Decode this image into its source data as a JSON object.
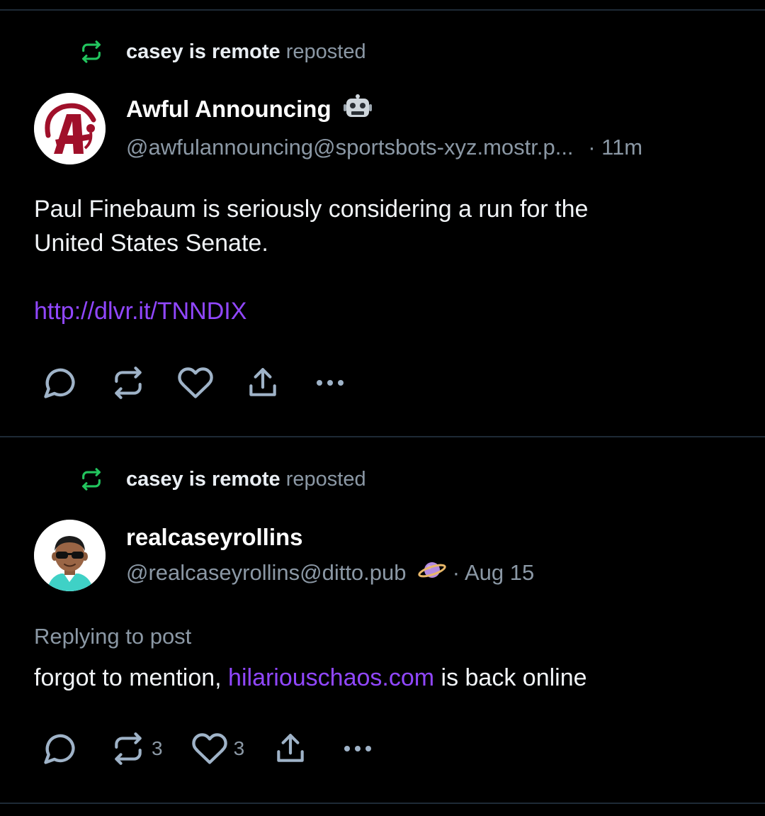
{
  "colors": {
    "background": "#000000",
    "divider": "#1e2a36",
    "muted_text": "#8b98a5",
    "link": "#9147ff",
    "repost_green": "#22c55e",
    "icon_stroke": "#9fb3c8"
  },
  "posts": [
    {
      "repost_by": "casey is remote",
      "repost_verb": "reposted",
      "author": {
        "display_name": "Awful Announcing",
        "badge_icon": "robot-icon",
        "handle": "@awfulannouncing@sportsbots-xyz.mostr.p...",
        "time": "· 11m"
      },
      "text_line1": "Paul Finebaum is seriously considering a run for the",
      "text_line2": "United States Senate.",
      "link": "http://dlvr.it/TNNDIX",
      "actions": {
        "reply_icon": "comment-icon",
        "repost_icon": "repost-icon",
        "like_icon": "heart-icon",
        "share_icon": "share-icon",
        "more_icon": "more-icon"
      }
    },
    {
      "repost_by": "casey is remote",
      "repost_verb": "reposted",
      "author": {
        "display_name": "realcaseyrollins",
        "handle": "@realcaseyrollins@ditto.pub",
        "badge_icon": "ringed-planet-icon",
        "time": "· Aug 15"
      },
      "reply_hint": "Replying to post",
      "text_before": "forgot to mention, ",
      "text_link": "hilariouschaos.com",
      "text_after": " is back online",
      "repost_count": "3",
      "like_count": "3",
      "actions": {
        "reply_icon": "comment-icon",
        "repost_icon": "repost-icon",
        "like_icon": "heart-icon",
        "share_icon": "share-icon",
        "more_icon": "more-icon"
      }
    }
  ]
}
